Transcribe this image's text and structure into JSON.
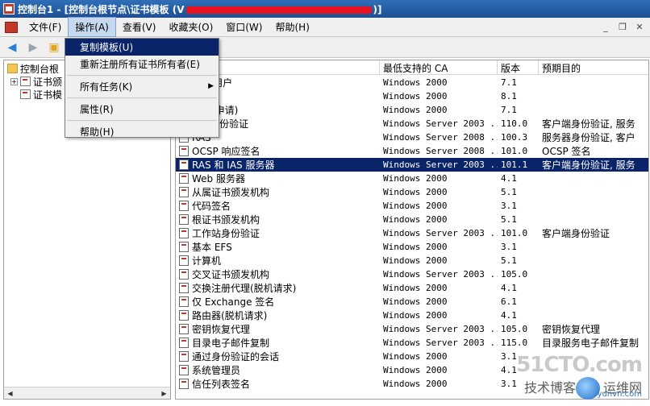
{
  "window": {
    "title_prefix": "控制台1 - [控制台根节点\\证书模板 (V",
    "title_suffix": ")]"
  },
  "menubar": {
    "items": [
      "文件(F)",
      "操作(A)",
      "查看(V)",
      "收藏夹(O)",
      "窗口(W)",
      "帮助(H)"
    ],
    "active_index": 1,
    "window_controls": [
      "_",
      "❐",
      "✕"
    ]
  },
  "context_menu": {
    "items": [
      {
        "label": "复制模板(U)",
        "highlighted": true,
        "submenu": false
      },
      {
        "label": "重新注册所有证书所有者(E)",
        "highlighted": false,
        "submenu": false
      },
      {
        "separator": true
      },
      {
        "label": "所有任务(K)",
        "highlighted": false,
        "submenu": true
      },
      {
        "separator": true
      },
      {
        "label": "属性(R)",
        "highlighted": false,
        "submenu": false
      },
      {
        "separator": true
      },
      {
        "label": "帮助(H)",
        "highlighted": false,
        "submenu": false
      }
    ]
  },
  "tree": {
    "items": [
      {
        "label": "控制台根",
        "icon": "folder-icon",
        "expander": ""
      },
      {
        "label": "证书颁",
        "icon": "cert-icon",
        "expander": "+"
      },
      {
        "label": "证书模",
        "icon": "cert-icon",
        "expander": ""
      }
    ]
  },
  "list": {
    "columns": [
      "名称",
      "最低支持的 CA",
      "版本",
      "预期目的"
    ],
    "rows": [
      {
        "name": "age 用户",
        "ca": "Windows 2000",
        "version": "7.1",
        "purpose": ""
      },
      {
        "name": "",
        "ca": "Windows 2000",
        "version": "8.1",
        "purpose": ""
      },
      {
        "name": "(脱机申请)",
        "ca": "Windows 2000",
        "version": "7.1",
        "purpose": ""
      },
      {
        "name": "ros 身份验证",
        "ca": "Windows Server 2003 ...",
        "version": "110.0",
        "purpose": "客户端身份验证, 服务"
      },
      {
        "name": "RAS",
        "ca": "Windows Server 2008 ...",
        "version": "100.3",
        "purpose": "服务器身份验证, 客户"
      },
      {
        "name": "OCSP 响应签名",
        "ca": "Windows Server 2008 ...",
        "version": "101.0",
        "purpose": "OCSP 签名"
      },
      {
        "name": "RAS 和 IAS 服务器",
        "ca": "Windows Server 2003 ...",
        "version": "101.1",
        "purpose": "客户端身份验证, 服务",
        "selected": true
      },
      {
        "name": "Web 服务器",
        "ca": "Windows 2000",
        "version": "4.1",
        "purpose": ""
      },
      {
        "name": "从属证书颁发机构",
        "ca": "Windows 2000",
        "version": "5.1",
        "purpose": ""
      },
      {
        "name": "代码签名",
        "ca": "Windows 2000",
        "version": "3.1",
        "purpose": ""
      },
      {
        "name": "根证书颁发机构",
        "ca": "Windows 2000",
        "version": "5.1",
        "purpose": ""
      },
      {
        "name": "工作站身份验证",
        "ca": "Windows Server 2003 ...",
        "version": "101.0",
        "purpose": "客户端身份验证"
      },
      {
        "name": "基本 EFS",
        "ca": "Windows 2000",
        "version": "3.1",
        "purpose": ""
      },
      {
        "name": "计算机",
        "ca": "Windows 2000",
        "version": "5.1",
        "purpose": ""
      },
      {
        "name": "交叉证书颁发机构",
        "ca": "Windows Server 2003 ...",
        "version": "105.0",
        "purpose": ""
      },
      {
        "name": "交换注册代理(脱机请求)",
        "ca": "Windows 2000",
        "version": "4.1",
        "purpose": ""
      },
      {
        "name": "仅 Exchange 签名",
        "ca": "Windows 2000",
        "version": "6.1",
        "purpose": ""
      },
      {
        "name": "路由器(脱机请求)",
        "ca": "Windows 2000",
        "version": "4.1",
        "purpose": ""
      },
      {
        "name": "密钥恢复代理",
        "ca": "Windows Server 2003 ...",
        "version": "105.0",
        "purpose": "密钥恢复代理"
      },
      {
        "name": "目录电子邮件复制",
        "ca": "Windows Server 2003 ...",
        "version": "115.0",
        "purpose": "目录服务电子邮件复制"
      },
      {
        "name": "通过身份验证的会话",
        "ca": "Windows 2000",
        "version": "3.1",
        "purpose": ""
      },
      {
        "name": "系统管理员",
        "ca": "Windows 2000",
        "version": "4.1",
        "purpose": ""
      },
      {
        "name": "信任列表签名",
        "ca": "Windows 2000",
        "version": "3.1",
        "purpose": ""
      }
    ]
  },
  "watermark": {
    "line1": "51CTO.com",
    "line2": "技术博客",
    "line2b": "运维网",
    "line3": "yunvn.com"
  }
}
